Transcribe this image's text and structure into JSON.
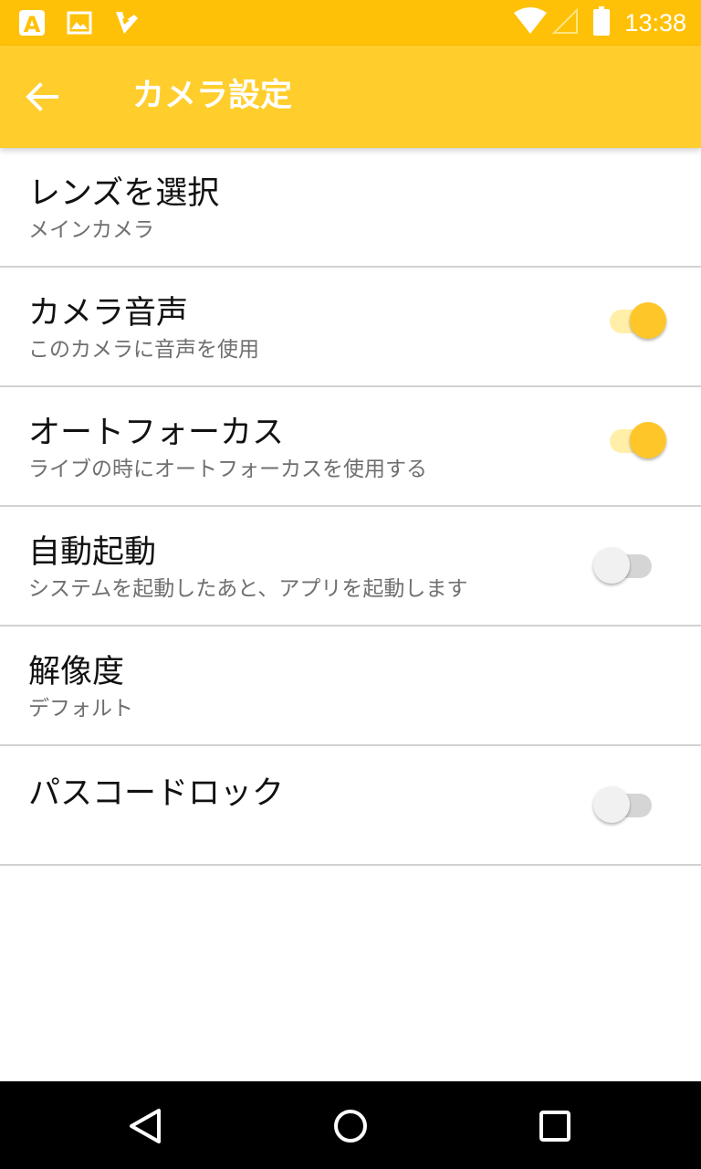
{
  "status_bar": {
    "time": "13:38",
    "icons": [
      "font-app-icon",
      "image-icon",
      "checkmark-app-icon",
      "wifi-icon",
      "cell-signal-icon",
      "battery-icon"
    ]
  },
  "app_bar": {
    "title": "カメラ設定",
    "back_icon": "arrow-back-icon",
    "color": "#FFCE2C"
  },
  "settings": [
    {
      "title": "レンズを選択",
      "summary": "メインカメラ"
    },
    {
      "title": "カメラ音声",
      "summary": "このカメラに音声を使用",
      "switch": true
    },
    {
      "title": "オートフォーカス",
      "summary": "ライブの時にオートフォーカスを使用する",
      "switch": true
    },
    {
      "title": "自動起動",
      "summary": "システムを起動したあと、アプリを起動します",
      "switch": false
    },
    {
      "title": "解像度",
      "summary": "デフォルト"
    },
    {
      "title": "パスコードロック",
      "switch": false
    }
  ],
  "nav_bar": {
    "icons": [
      "back-triangle-icon",
      "home-circle-icon",
      "recents-square-icon"
    ]
  },
  "colors": {
    "status_bar": "#FFC107",
    "accent": "#FFC62A",
    "switch_track_on": "#FFEFA8"
  }
}
